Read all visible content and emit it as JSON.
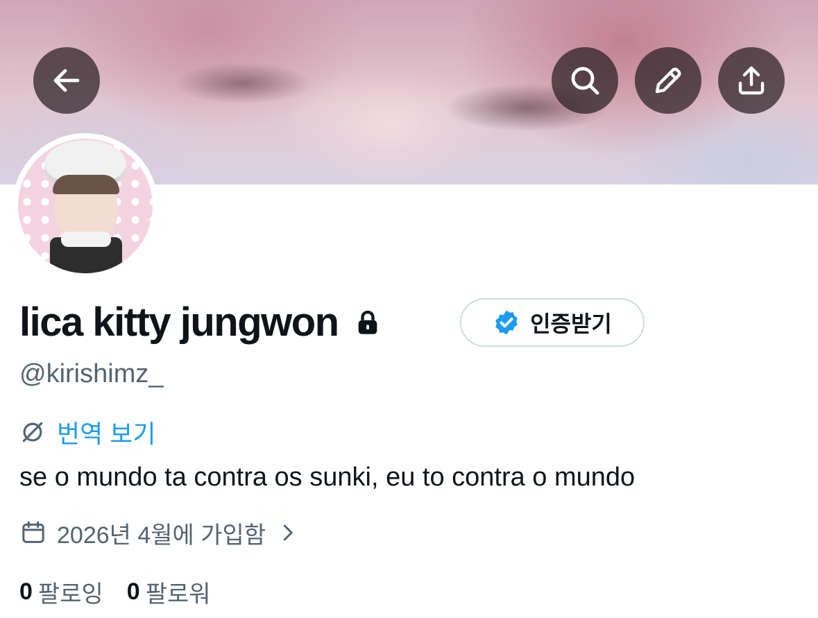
{
  "profile": {
    "display_name": "lica kitty jungwon",
    "handle": "@kirishimz_",
    "verify_label": "인증받기",
    "translate_label": "번역 보기",
    "bio": "se o mundo ta contra os sunki, eu to contra o mundo",
    "joined": "2026년 4월에 가입함",
    "following_count": "0",
    "following_label": "팔로잉",
    "followers_count": "0",
    "followers_label": "팔로워"
  },
  "icons": {
    "back": "arrow-left-icon",
    "search": "search-icon",
    "edit": "pencil-icon",
    "share": "share-upload-icon",
    "lock": "lock-icon",
    "verified": "verified-badge-icon",
    "translate": "globe-icon",
    "calendar": "calendar-icon",
    "chevron": "chevron-right-icon"
  },
  "colors": {
    "text_primary": "#0f1419",
    "text_secondary": "#536471",
    "accent_blue": "#1d9bf0",
    "button_border": "#cfd9de"
  }
}
